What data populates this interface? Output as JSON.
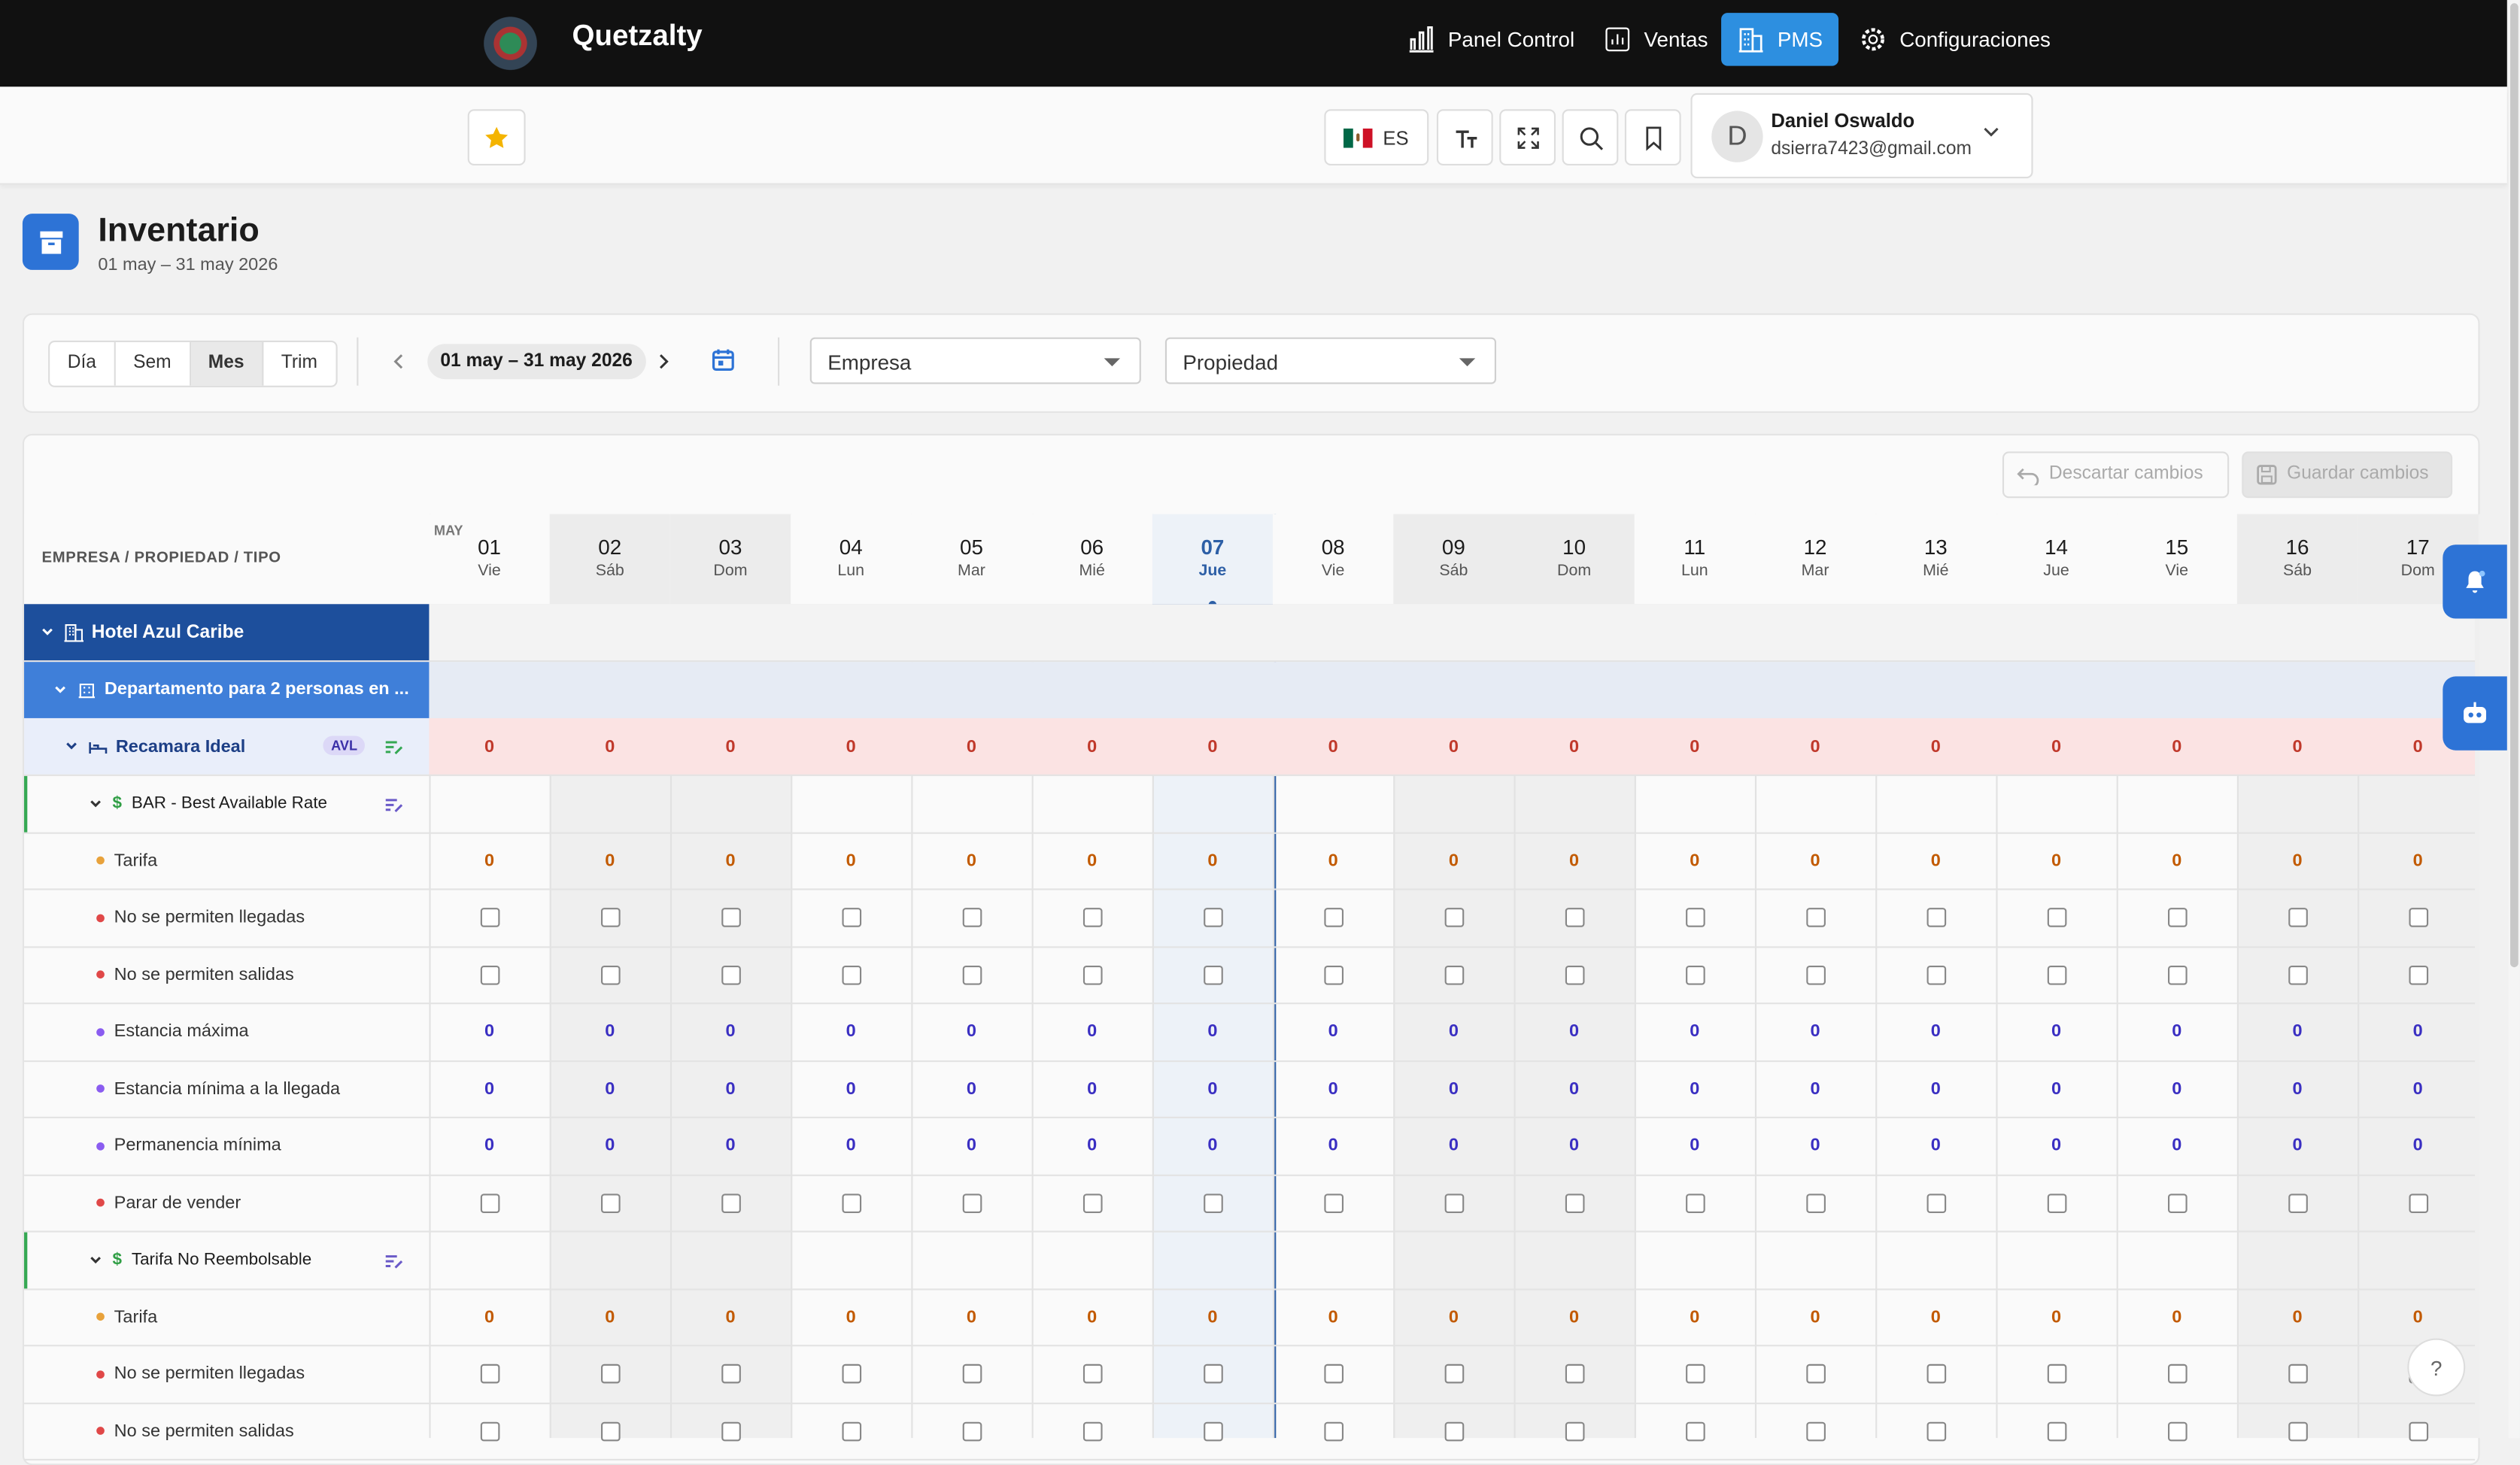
{
  "app": {
    "brand": "Quetzalty"
  },
  "nav": [
    {
      "label": "Panel Control",
      "icon": "bar-chart-icon"
    },
    {
      "label": "Ventas",
      "icon": "analytics-icon"
    },
    {
      "label": "PMS",
      "icon": "building-icon",
      "active": true
    },
    {
      "label": "Configuraciones",
      "icon": "gear-icon"
    }
  ],
  "toolbar": {
    "lang": "ES"
  },
  "user": {
    "initial": "D",
    "name": "Daniel Oswaldo",
    "email": "dsierra7423@gmail.com"
  },
  "page": {
    "title": "Inventario",
    "range": "01 may – 31 may 2026"
  },
  "filters": {
    "views": [
      "Día",
      "Sem",
      "Mes",
      "Trim"
    ],
    "active_view": "Mes",
    "range": "01 may – 31 may 2026",
    "empresa_placeholder": "Empresa",
    "propiedad_placeholder": "Propiedad"
  },
  "actions": {
    "discard": "Descartar cambios",
    "save": "Guardar cambios"
  },
  "grid": {
    "header_label": "EMPRESA / PROPIEDAD / TIPO",
    "month": "MAY",
    "today_index": 6,
    "days": [
      {
        "n": "01",
        "w": "Vie"
      },
      {
        "n": "02",
        "w": "Sáb"
      },
      {
        "n": "03",
        "w": "Dom"
      },
      {
        "n": "04",
        "w": "Lun"
      },
      {
        "n": "05",
        "w": "Mar"
      },
      {
        "n": "06",
        "w": "Mié"
      },
      {
        "n": "07",
        "w": "Jue"
      },
      {
        "n": "08",
        "w": "Vie"
      },
      {
        "n": "09",
        "w": "Sáb"
      },
      {
        "n": "10",
        "w": "Dom"
      },
      {
        "n": "11",
        "w": "Lun"
      },
      {
        "n": "12",
        "w": "Mar"
      },
      {
        "n": "13",
        "w": "Mié"
      },
      {
        "n": "14",
        "w": "Jue"
      },
      {
        "n": "15",
        "w": "Vie"
      },
      {
        "n": "16",
        "w": "Sáb"
      },
      {
        "n": "17",
        "w": "Dom"
      }
    ],
    "rows": [
      {
        "type": "hotel",
        "label": "Hotel Azul Caribe"
      },
      {
        "type": "property",
        "label": "Departamento para 2 personas en ..."
      },
      {
        "type": "room",
        "label": "Recamara Ideal",
        "badge": "AVL",
        "value": "0"
      },
      {
        "type": "rate",
        "label": "BAR - Best Available Rate"
      },
      {
        "type": "num",
        "label": "Tarifa",
        "dot": "#e8a23b",
        "value": "0",
        "color": "#c25a00"
      },
      {
        "type": "check",
        "label": "No se permiten llegadas",
        "dot": "#e04848"
      },
      {
        "type": "check",
        "label": "No se permiten salidas",
        "dot": "#e04848"
      },
      {
        "type": "num",
        "label": "Estancia máxima",
        "dot": "#8a5cf0",
        "value": "0",
        "color": "#3a2fc2"
      },
      {
        "type": "num",
        "label": "Estancia mínima a la llegada",
        "dot": "#8a5cf0",
        "value": "0",
        "color": "#3a2fc2"
      },
      {
        "type": "num",
        "label": "Permanencia mínima",
        "dot": "#8a5cf0",
        "value": "0",
        "color": "#3a2fc2"
      },
      {
        "type": "check",
        "label": "Parar de vender",
        "dot": "#e04848"
      },
      {
        "type": "rate",
        "label": "Tarifa No Reembolsable"
      },
      {
        "type": "num",
        "label": "Tarifa",
        "dot": "#e8a23b",
        "value": "0",
        "color": "#c25a00"
      },
      {
        "type": "check",
        "label": "No se permiten llegadas",
        "dot": "#e04848"
      },
      {
        "type": "check",
        "label": "No se permiten salidas",
        "dot": "#e04848"
      }
    ]
  },
  "colors": {
    "accent": "#2d73d6",
    "hotel": "#1d4f9c",
    "property": "#3f7fd9",
    "room_row": "#fbe3e3"
  }
}
